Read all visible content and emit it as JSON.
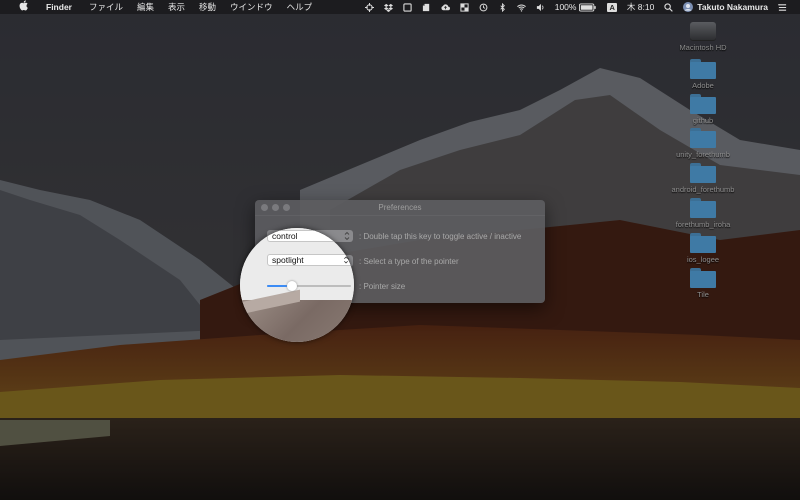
{
  "menubar": {
    "app_name": "Finder",
    "items": [
      "ファイル",
      "編集",
      "表示",
      "移動",
      "ウインドウ",
      "ヘルプ"
    ],
    "battery_percent": "100%",
    "input_mode": "A",
    "clock": "木 8:10",
    "user_name": "Takuto Nakamura",
    "icons": [
      "crosshair-icon",
      "dropbox-icon",
      "window-icon",
      "evernote-icon",
      "cloud-upload-icon",
      "display-icon",
      "time-machine-icon",
      "bluetooth-icon",
      "wifi-icon",
      "volume-icon",
      "battery-icon",
      "input-source-icon",
      "spotlight-search-icon",
      "user-avatar",
      "notification-center-icon"
    ]
  },
  "desktop": {
    "icons": [
      {
        "label": "Macintosh HD",
        "kind": "drive"
      },
      {
        "label": "Adobe",
        "kind": "folder"
      },
      {
        "label": "github",
        "kind": "folder"
      },
      {
        "label": "unity_forethumb",
        "kind": "folder"
      },
      {
        "label": "android_forethumb",
        "kind": "folder"
      },
      {
        "label": "forethumb_iroha",
        "kind": "folder"
      },
      {
        "label": "ios_logee",
        "kind": "folder"
      },
      {
        "label": "Tile",
        "kind": "folder"
      }
    ]
  },
  "prefs": {
    "title": "Preferences",
    "toggle_key": {
      "value": "control",
      "description": ": Double tap this key to toggle active / inactive"
    },
    "pointer_type": {
      "value": "spotlight",
      "description": ": Select a type of the pointer"
    },
    "pointer_size": {
      "value_fraction": 0.3,
      "description": ": Pointer size"
    }
  },
  "colors": {
    "accent": "#3d8cf5",
    "folder": "#3f7aa5",
    "menubar": "#1a1a1c"
  }
}
